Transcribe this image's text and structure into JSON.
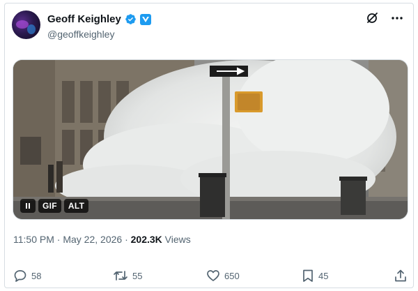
{
  "author": {
    "name": "Geoff Keighley",
    "handle": "@geoffkeighley"
  },
  "header_icons": [
    "grok-icon",
    "more-icon"
  ],
  "media": {
    "badges": [
      "GIF",
      "ALT"
    ],
    "icon": "pause-icon"
  },
  "meta": {
    "time": "11:50 PM",
    "separator1": " · ",
    "date": "May 22, 2026",
    "separator2": " · ",
    "views_count": "202.3K",
    "views_label": " Views"
  },
  "actions": {
    "replies": "58",
    "reposts": "55",
    "likes": "650",
    "bookmarks": "45"
  },
  "colors": {
    "verified": "#1d9bf0",
    "text_secondary": "#536471",
    "text_primary": "#0f1419"
  }
}
